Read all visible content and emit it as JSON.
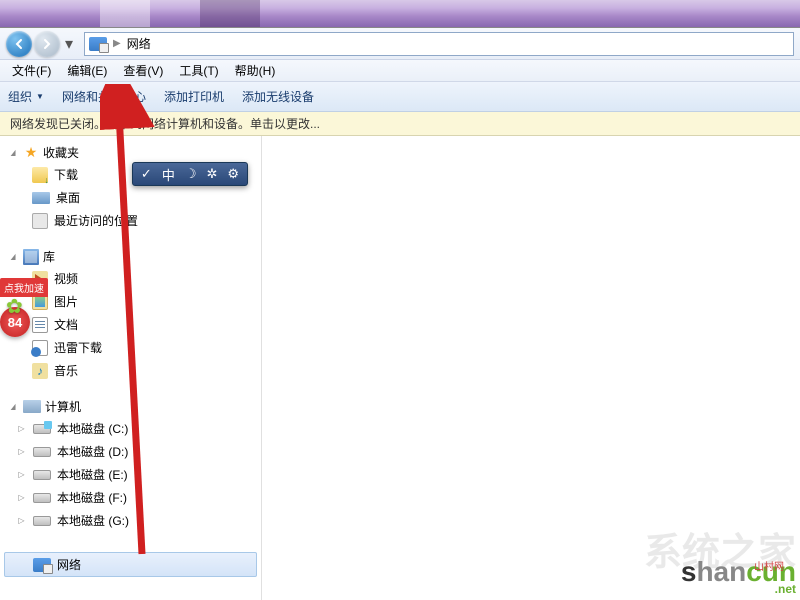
{
  "address": {
    "location": "网络"
  },
  "menubar": {
    "file": "文件(F)",
    "edit": "编辑(E)",
    "view": "查看(V)",
    "tools": "工具(T)",
    "help": "帮助(H)"
  },
  "toolbar": {
    "organize": "组织",
    "network_center": "网络和共享中心",
    "add_printer": "添加打印机",
    "add_wireless": "添加无线设备"
  },
  "infobar": {
    "message": "网络发现已关闭。看不到网络计算机和设备。单击以更改..."
  },
  "sidebar": {
    "favorites": {
      "header": "收藏夹",
      "downloads": "下载",
      "desktop": "桌面",
      "recent": "最近访问的位置"
    },
    "libraries": {
      "header": "库",
      "videos": "视频",
      "pictures": "图片",
      "documents": "文档",
      "xunlei": "迅雷下载",
      "music": "音乐"
    },
    "computer": {
      "header": "计算机",
      "drive_c": "本地磁盘 (C:)",
      "drive_d": "本地磁盘 (D:)",
      "drive_e": "本地磁盘 (E:)",
      "drive_f": "本地磁盘 (F:)",
      "drive_g": "本地磁盘 (G:)"
    },
    "network": "网络"
  },
  "badge": {
    "accel": "点我加速",
    "count": "84"
  },
  "widget": {
    "s1": "✓",
    "s2": "中",
    "s3": "☽",
    "s4": "✲",
    "s5": "⚙"
  },
  "watermark": {
    "bg": "系统之家",
    "s": "s",
    "han": "han",
    "cun": "cun",
    "cn": "山村网",
    "net": ".net"
  }
}
